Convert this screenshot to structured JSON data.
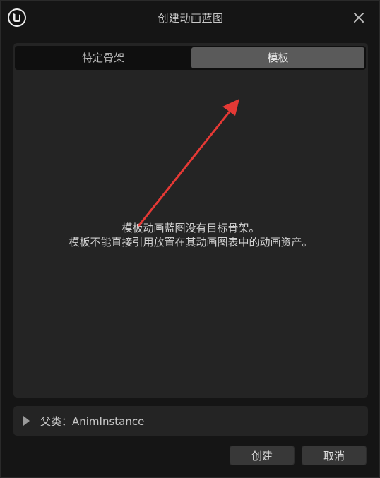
{
  "window": {
    "title": "创建动画蓝图",
    "logo_icon": "unreal-engine-logo",
    "close_icon": "close-icon"
  },
  "tabs": [
    {
      "label": "特定骨架",
      "selected": false
    },
    {
      "label": "模板",
      "selected": true
    }
  ],
  "message": {
    "line1": "模板动画蓝图没有目标骨架。",
    "line2": "模板不能直接引用放置在其动画图表中的动画资产。"
  },
  "parent_class": {
    "label": "父类：AnimInstance",
    "expanded": false
  },
  "buttons": {
    "create": "创建",
    "cancel": "取消"
  },
  "annotation": {
    "type": "red-arrow",
    "color": "#e53935"
  }
}
